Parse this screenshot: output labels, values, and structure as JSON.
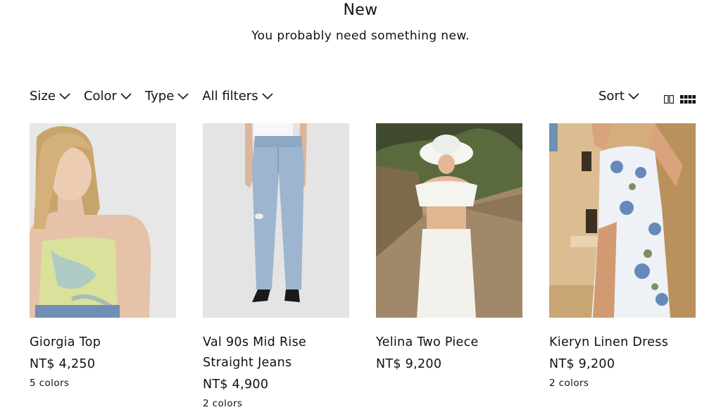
{
  "header": {
    "title": "New",
    "subtitle": "You probably need something new."
  },
  "filters": [
    {
      "label": "Size"
    },
    {
      "label": "Color"
    },
    {
      "label": "Type"
    },
    {
      "label": "All filters"
    }
  ],
  "sort": {
    "label": "Sort"
  },
  "view_toggle": {
    "icons": [
      "two-column-grid-icon",
      "four-column-grid-icon"
    ]
  },
  "products": [
    {
      "name": "Giorgia Top",
      "price": "NT$ 4,250",
      "colors": "5 colors"
    },
    {
      "name": "Val 90s Mid Rise Straight Jeans",
      "price": "NT$ 4,900",
      "colors": "2 colors"
    },
    {
      "name": "Yelina Two Piece",
      "price": "NT$ 9,200",
      "colors": ""
    },
    {
      "name": "Kieryn Linen Dress",
      "price": "NT$ 9,200",
      "colors": "2 colors"
    }
  ],
  "colors": {
    "text": "#111111",
    "background": "#ffffff"
  }
}
